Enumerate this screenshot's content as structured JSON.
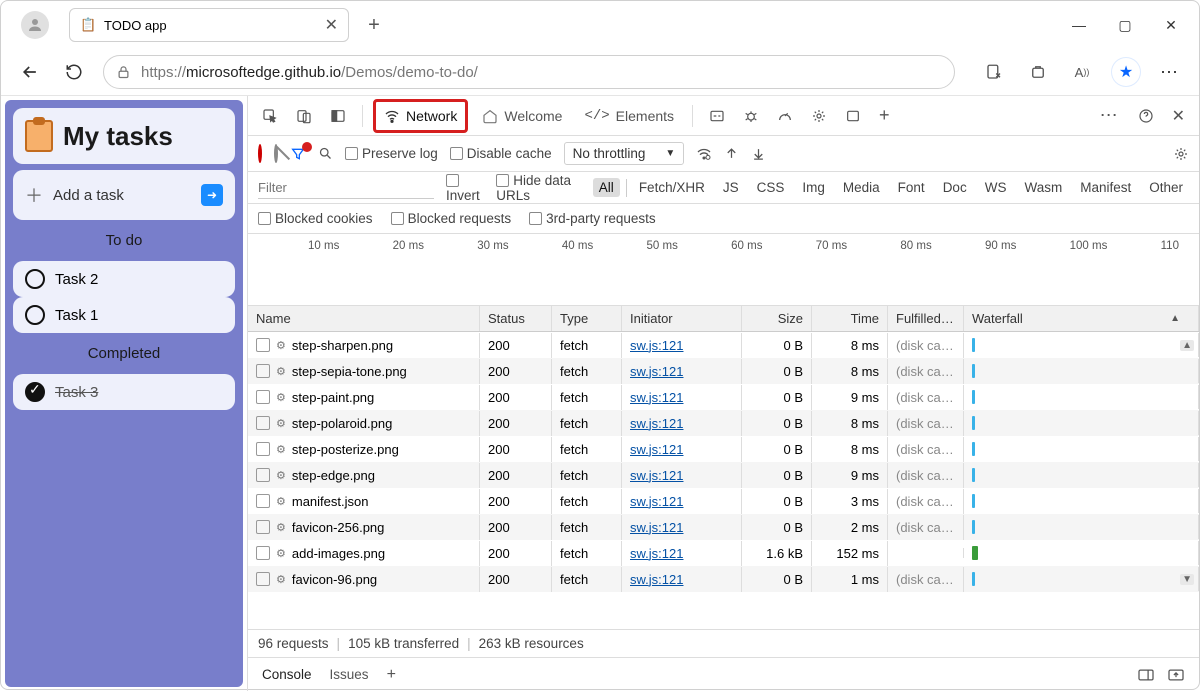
{
  "browser": {
    "tab_title": "TODO app",
    "url_prefix": "https://",
    "url_host": "microsoftedge.github.io",
    "url_path": "/Demos/demo-to-do/"
  },
  "app": {
    "title": "My tasks",
    "add_label": "Add a task",
    "sections": {
      "todo": "To do",
      "done": "Completed"
    },
    "tasks_todo": [
      "Task 2",
      "Task 1"
    ],
    "tasks_done": [
      "Task 3"
    ]
  },
  "devtools": {
    "tabs": {
      "network": "Network",
      "welcome": "Welcome",
      "elements": "Elements"
    },
    "preserve_log": "Preserve log",
    "disable_cache": "Disable cache",
    "throttling": "No throttling",
    "filter_placeholder": "Filter",
    "invert": "Invert",
    "hide_data_urls": "Hide data URLs",
    "types": [
      "All",
      "Fetch/XHR",
      "JS",
      "CSS",
      "Img",
      "Media",
      "Font",
      "Doc",
      "WS",
      "Wasm",
      "Manifest",
      "Other"
    ],
    "blocked_cookies": "Blocked cookies",
    "blocked_requests": "Blocked requests",
    "third_party": "3rd-party requests",
    "timeline_ticks": [
      "10 ms",
      "20 ms",
      "30 ms",
      "40 ms",
      "50 ms",
      "60 ms",
      "70 ms",
      "80 ms",
      "90 ms",
      "100 ms",
      "110"
    ],
    "columns": {
      "name": "Name",
      "status": "Status",
      "type": "Type",
      "initiator": "Initiator",
      "size": "Size",
      "time": "Time",
      "fulfilled": "Fulfilled…",
      "waterfall": "Waterfall"
    },
    "rows": [
      {
        "name": "step-sharpen.png",
        "status": "200",
        "type": "fetch",
        "initiator": "sw.js:121",
        "size": "0 B",
        "time": "8 ms",
        "fulfilled": "(disk ca…"
      },
      {
        "name": "step-sepia-tone.png",
        "status": "200",
        "type": "fetch",
        "initiator": "sw.js:121",
        "size": "0 B",
        "time": "8 ms",
        "fulfilled": "(disk ca…"
      },
      {
        "name": "step-paint.png",
        "status": "200",
        "type": "fetch",
        "initiator": "sw.js:121",
        "size": "0 B",
        "time": "9 ms",
        "fulfilled": "(disk ca…"
      },
      {
        "name": "step-polaroid.png",
        "status": "200",
        "type": "fetch",
        "initiator": "sw.js:121",
        "size": "0 B",
        "time": "8 ms",
        "fulfilled": "(disk ca…"
      },
      {
        "name": "step-posterize.png",
        "status": "200",
        "type": "fetch",
        "initiator": "sw.js:121",
        "size": "0 B",
        "time": "8 ms",
        "fulfilled": "(disk ca…"
      },
      {
        "name": "step-edge.png",
        "status": "200",
        "type": "fetch",
        "initiator": "sw.js:121",
        "size": "0 B",
        "time": "9 ms",
        "fulfilled": "(disk ca…"
      },
      {
        "name": "manifest.json",
        "status": "200",
        "type": "fetch",
        "initiator": "sw.js:121",
        "size": "0 B",
        "time": "3 ms",
        "fulfilled": "(disk ca…"
      },
      {
        "name": "favicon-256.png",
        "status": "200",
        "type": "fetch",
        "initiator": "sw.js:121",
        "size": "0 B",
        "time": "2 ms",
        "fulfilled": "(disk ca…"
      },
      {
        "name": "add-images.png",
        "status": "200",
        "type": "fetch",
        "initiator": "sw.js:121",
        "size": "1.6 kB",
        "time": "152 ms",
        "fulfilled": ""
      },
      {
        "name": "favicon-96.png",
        "status": "200",
        "type": "fetch",
        "initiator": "sw.js:121",
        "size": "0 B",
        "time": "1 ms",
        "fulfilled": "(disk ca…"
      }
    ],
    "status": {
      "requests": "96 requests",
      "transferred": "105 kB transferred",
      "resources": "263 kB resources"
    },
    "drawer": {
      "console": "Console",
      "issues": "Issues"
    }
  }
}
